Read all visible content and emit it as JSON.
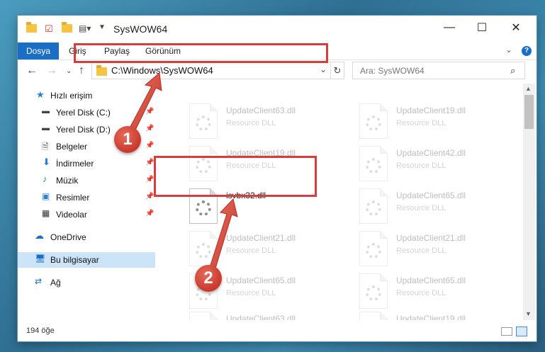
{
  "window": {
    "title": "SysWOW64"
  },
  "controls": {
    "minimize": "—",
    "maximize": "☐",
    "close": "✕"
  },
  "ribbon": {
    "tabs": [
      "Dosya",
      "Giriş",
      "Paylaş",
      "Görünüm"
    ],
    "help": "?"
  },
  "nav": {
    "address": "C:\\Windows\\SysWOW64",
    "search_placeholder": "Ara: SysWOW64"
  },
  "sidebar": {
    "items": [
      {
        "label": "Hızlı erişim",
        "icon": "star-icon"
      },
      {
        "label": "Yerel Disk (C:)",
        "icon": "drive-icon",
        "pinned": true
      },
      {
        "label": "Yerel Disk (D:)",
        "icon": "drive-icon",
        "pinned": true
      },
      {
        "label": "Belgeler",
        "icon": "documents-icon",
        "pinned": true
      },
      {
        "label": "İndirmeler",
        "icon": "download-icon",
        "pinned": true
      },
      {
        "label": "Müzik",
        "icon": "music-icon",
        "pinned": true
      },
      {
        "label": "Resimler",
        "icon": "pictures-icon",
        "pinned": true
      },
      {
        "label": "Videolar",
        "icon": "videos-icon",
        "pinned": true
      },
      {
        "label": "OneDrive",
        "icon": "cloud-icon"
      },
      {
        "label": "Bu bilgisayar",
        "icon": "computer-icon",
        "selected": true
      },
      {
        "label": "Ağ",
        "icon": "network-icon"
      }
    ]
  },
  "files": [
    {
      "name": "UpdateClient63.dll",
      "desc": "Resource DLL",
      "faded": true
    },
    {
      "name": "UpdateClient19.dll",
      "desc": "Resource DLL",
      "faded": true
    },
    {
      "name": "UpdateClient19.dll",
      "desc": "Resource DLL",
      "faded": true
    },
    {
      "name": "UpdateClient42.dll",
      "desc": "Resource DLL",
      "faded": true
    },
    {
      "name": "isvbx32.dll",
      "desc": "",
      "faded": false
    },
    {
      "name": "UpdateClient65.dll",
      "desc": "Resource DLL",
      "faded": true
    },
    {
      "name": "UpdateClient21.dll",
      "desc": "Resource DLL",
      "faded": true
    },
    {
      "name": "UpdateClient21.dll",
      "desc": "Resource DLL",
      "faded": true
    },
    {
      "name": "UpdateClient65.dll",
      "desc": "Resource DLL",
      "faded": true
    },
    {
      "name": "UpdateClient65.dll",
      "desc": "Resource DLL",
      "faded": true
    },
    {
      "name": "UpdateClient63.dll",
      "desc": "Resource DLL",
      "faded": true
    },
    {
      "name": "UpdateClient19.dll",
      "desc": "Resource DLL",
      "faded": true
    }
  ],
  "status": {
    "count": "194 öğe"
  },
  "annotations": {
    "step1": "1",
    "step2": "2",
    "color": "#d63d3d"
  }
}
